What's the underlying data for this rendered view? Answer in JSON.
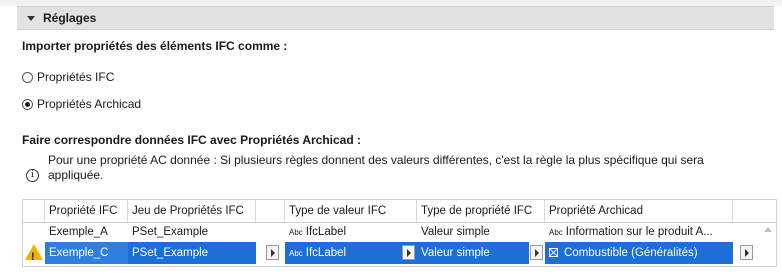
{
  "section": {
    "title": "Réglages"
  },
  "import": {
    "heading": "Importer propriétés des éléments IFC comme :",
    "options": [
      {
        "label": "Propriétés IFC",
        "checked": false
      },
      {
        "label": "Propriétés Archicad",
        "checked": true
      }
    ]
  },
  "mapping": {
    "heading": "Faire correspondre données IFC avec Propriétés Archicad :",
    "info_line1": "Pour une propriété AC donnée : Si plusieurs règles donnent des valeurs différentes, c'est la règle la plus spécifique qui sera",
    "info_line2": "appliquée."
  },
  "table": {
    "columns": [
      "Propriété IFC",
      "Jeu de Propriétés IFC",
      "Type de valeur IFC",
      "Type de propriété IFC",
      "Propriété Archicad"
    ],
    "rows": [
      {
        "prop": "Exemple_A",
        "pset": "PSet_Example",
        "value_type_prefix": "Abc",
        "value_type": "IfcLabel",
        "prop_type": "Valeur simple",
        "archicad_prefix": "Abc",
        "archicad": "Information sur le produit A...",
        "warning": false,
        "selected": false
      },
      {
        "prop": "Exemple_C",
        "pset": "PSet_Example",
        "value_type_prefix": "Abc",
        "value_type": "IfcLabel",
        "prop_type": "Valeur simple",
        "archicad": "Combustible (Généralités)",
        "warning": true,
        "selected": true
      }
    ]
  },
  "icons": {
    "info": "info-icon",
    "warning": "warning-icon",
    "expand": "triangle-down-icon"
  },
  "colors": {
    "selection": "#1c6fd6",
    "warning": "#f0b400",
    "header": "#e2e2e2"
  }
}
